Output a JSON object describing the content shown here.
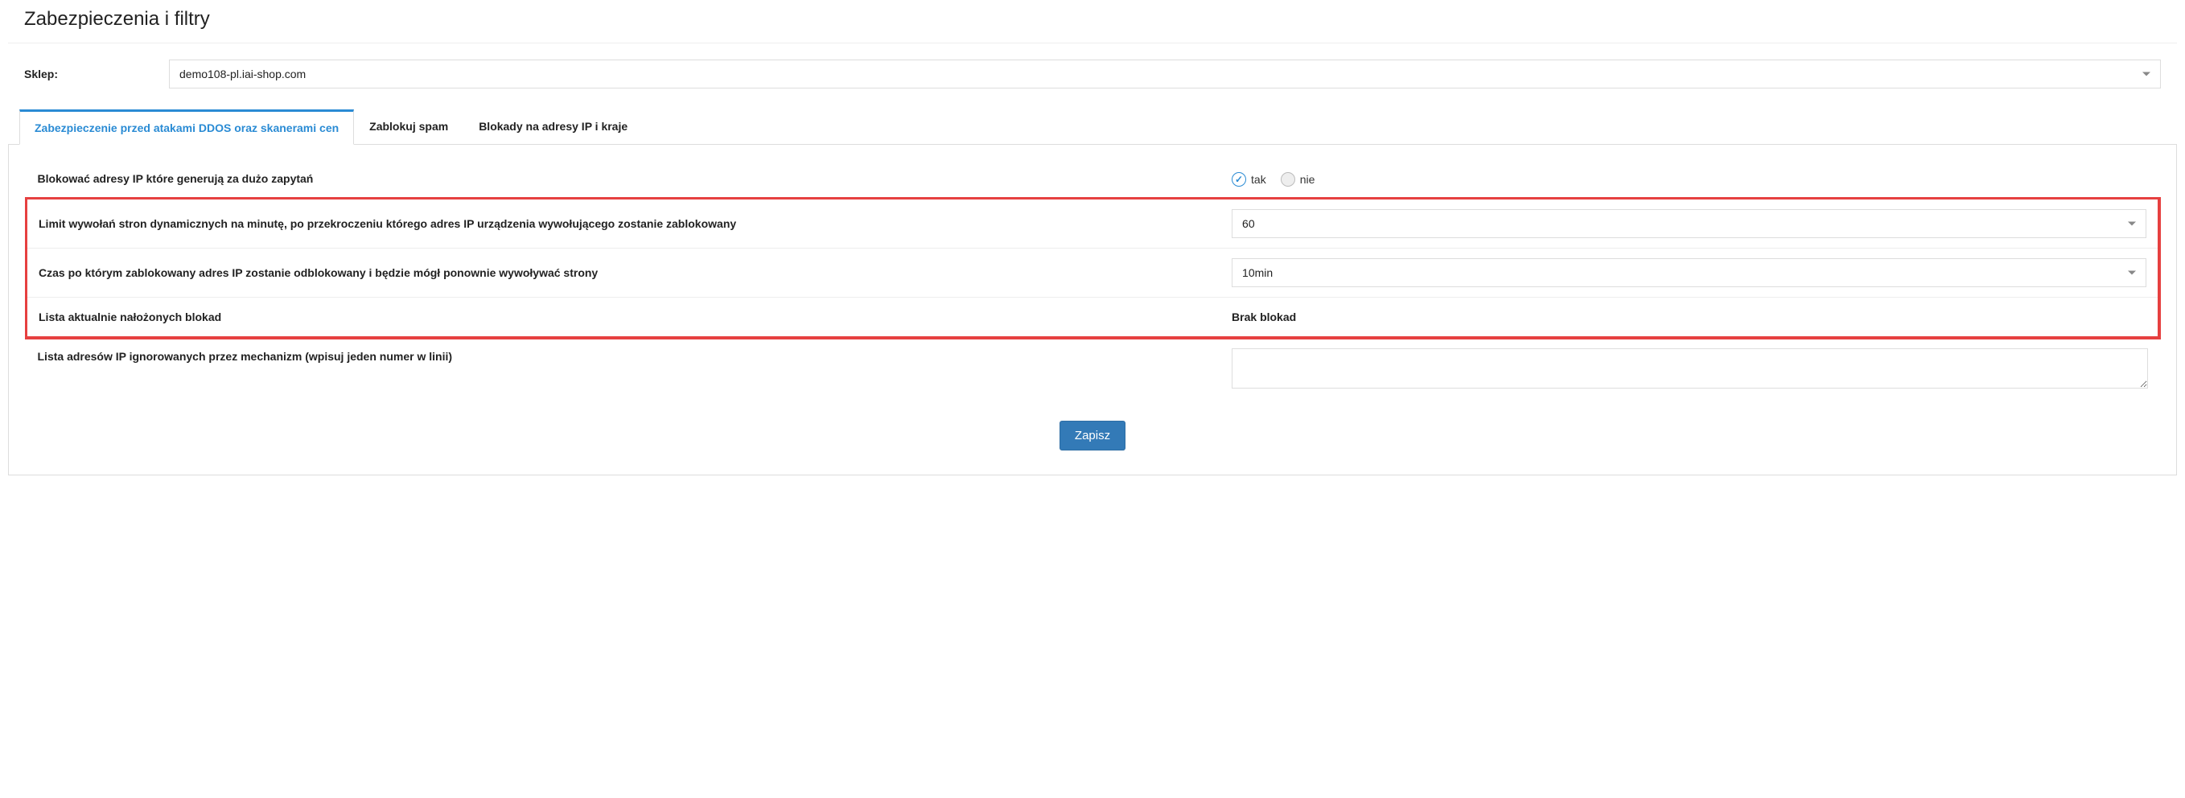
{
  "page_title": "Zabezpieczenia i filtry",
  "shop": {
    "label": "Sklep:",
    "selected": "demo108-pl.iai-shop.com"
  },
  "tabs": [
    {
      "id": "ddos",
      "label": "Zabezpieczenie przed atakami DDOS oraz skanerami cen",
      "active": true
    },
    {
      "id": "spam",
      "label": "Zablokuj spam",
      "active": false
    },
    {
      "id": "ipblock",
      "label": "Blokady na adresy IP i kraje",
      "active": false
    }
  ],
  "settings": {
    "block_ips": {
      "label": "Blokować adresy IP które generują za dużo zapytań",
      "value": "tak",
      "options": {
        "yes": "tak",
        "no": "nie"
      }
    },
    "limit_calls": {
      "label": "Limit wywołań stron dynamicznych na minutę, po przekroczeniu którego adres IP urządzenia wywołującego zostanie zablokowany",
      "value": "60"
    },
    "unblock_time": {
      "label": "Czas po którym zablokowany adres IP zostanie odblokowany i będzie mógł ponownie wywoływać strony",
      "value": "10min"
    },
    "current_blocks": {
      "label": "Lista aktualnie nałożonych blokad",
      "value": "Brak blokad"
    },
    "ignored_ips": {
      "label": "Lista adresów IP ignorowanych przez mechanizm (wpisuj jeden numer w linii)",
      "value": ""
    }
  },
  "buttons": {
    "save": "Zapisz"
  }
}
